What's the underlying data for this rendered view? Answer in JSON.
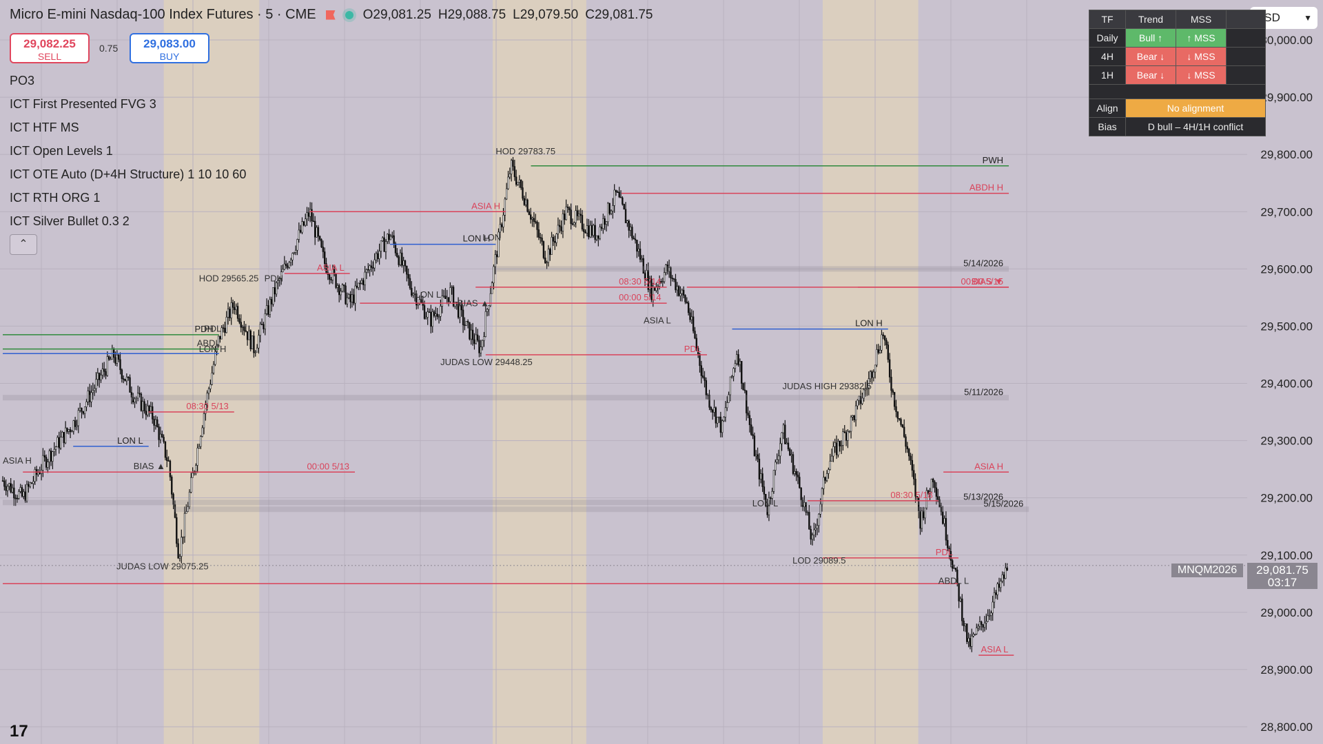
{
  "header": {
    "symbol_title": "Micro E-mini Nasdaq-100 Index Futures · 5 · CME",
    "open": "O29,081.25",
    "high": "H29,088.75",
    "low": "L29,079.50",
    "close": "C29,081.75"
  },
  "trade": {
    "sell_price": "29,082.25",
    "sell_label": "SELL",
    "spread": "0.75",
    "buy_price": "29,083.00",
    "buy_label": "BUY"
  },
  "indicators": [
    "PO3",
    "ICT First Presented FVG 3",
    "ICT HTF MS",
    "ICT Open Levels 1",
    "ICT OTE Auto (D+4H Structure) 1 10 10 60",
    "ICT RTH ORG 1",
    "ICT Silver Bullet 0.3 2"
  ],
  "collapse_glyph": "⌃",
  "currency": "USD",
  "mtf_table": {
    "headers": [
      "TF",
      "Trend",
      "MSS"
    ],
    "rows": [
      {
        "tf": "Daily",
        "trend": "Bull ↑",
        "mss": "↑ MSS"
      },
      {
        "tf": "4H",
        "trend": "Bear ↓",
        "mss": "↓ MSS"
      },
      {
        "tf": "1H",
        "trend": "Bear ↓",
        "mss": "↓ MSS"
      }
    ],
    "align_label": "Align",
    "align_value": "No alignment",
    "bias_label": "Bias",
    "bias_value": "D bull – 4H/1H conflict"
  },
  "last_price": {
    "symbol": "MNQM2026",
    "price": "29,081.75",
    "countdown": "03:17"
  },
  "logo_text": "17",
  "colors": {
    "up_session": "#e2d4b8",
    "background": "#c9c2cf",
    "level_red": "#d9435a",
    "level_green": "#2f8a3c",
    "level_blue": "#2f5fd0",
    "candles": "#111111"
  },
  "chart_data": {
    "type": "line",
    "title": "Micro E-mini Nasdaq-100 Index Futures · 5 · CME",
    "xlabel": "",
    "ylabel": "",
    "ylim": [
      28800,
      30000
    ],
    "y_ticks": [
      30000,
      29900,
      29800,
      29700,
      29600,
      29500,
      29400,
      29300,
      29200,
      29100,
      29000,
      28900,
      28800
    ],
    "y_tick_labels": [
      "30,000.00",
      "29,900.00",
      "29,800.00",
      "29,700.00",
      "29,600.00",
      "29,500.00",
      "29,400.00",
      "29,300.00",
      "29,200.00",
      "29,100.00",
      "29,000.00",
      "28,900.00",
      "28,800.00"
    ],
    "x_range": [
      0,
      1000
    ],
    "price_path": [
      {
        "t": 0,
        "p": 29230
      },
      {
        "t": 20,
        "p": 29200
      },
      {
        "t": 40,
        "p": 29260
      },
      {
        "t": 70,
        "p": 29330
      },
      {
        "t": 90,
        "p": 29390
      },
      {
        "t": 110,
        "p": 29450
      },
      {
        "t": 130,
        "p": 29380
      },
      {
        "t": 150,
        "p": 29340
      },
      {
        "t": 165,
        "p": 29260
      },
      {
        "t": 175,
        "p": 29100
      },
      {
        "t": 185,
        "p": 29200
      },
      {
        "t": 200,
        "p": 29350
      },
      {
        "t": 215,
        "p": 29480
      },
      {
        "t": 230,
        "p": 29540
      },
      {
        "t": 250,
        "p": 29460
      },
      {
        "t": 270,
        "p": 29560
      },
      {
        "t": 290,
        "p": 29640
      },
      {
        "t": 305,
        "p": 29700
      },
      {
        "t": 320,
        "p": 29610
      },
      {
        "t": 345,
        "p": 29540
      },
      {
        "t": 370,
        "p": 29620
      },
      {
        "t": 385,
        "p": 29660
      },
      {
        "t": 405,
        "p": 29570
      },
      {
        "t": 425,
        "p": 29510
      },
      {
        "t": 445,
        "p": 29560
      },
      {
        "t": 460,
        "p": 29500
      },
      {
        "t": 475,
        "p": 29460
      },
      {
        "t": 490,
        "p": 29620
      },
      {
        "t": 505,
        "p": 29780
      },
      {
        "t": 520,
        "p": 29720
      },
      {
        "t": 540,
        "p": 29620
      },
      {
        "t": 560,
        "p": 29700
      },
      {
        "t": 590,
        "p": 29660
      },
      {
        "t": 610,
        "p": 29730
      },
      {
        "t": 630,
        "p": 29640
      },
      {
        "t": 645,
        "p": 29560
      },
      {
        "t": 660,
        "p": 29600
      },
      {
        "t": 680,
        "p": 29540
      },
      {
        "t": 700,
        "p": 29380
      },
      {
        "t": 715,
        "p": 29320
      },
      {
        "t": 730,
        "p": 29460
      },
      {
        "t": 745,
        "p": 29300
      },
      {
        "t": 760,
        "p": 29180
      },
      {
        "t": 775,
        "p": 29320
      },
      {
        "t": 795,
        "p": 29200
      },
      {
        "t": 805,
        "p": 29120
      },
      {
        "t": 820,
        "p": 29260
      },
      {
        "t": 840,
        "p": 29320
      },
      {
        "t": 860,
        "p": 29400
      },
      {
        "t": 875,
        "p": 29490
      },
      {
        "t": 885,
        "p": 29380
      },
      {
        "t": 900,
        "p": 29280
      },
      {
        "t": 912,
        "p": 29160
      },
      {
        "t": 925,
        "p": 29240
      },
      {
        "t": 945,
        "p": 29080
      },
      {
        "t": 960,
        "p": 28940
      },
      {
        "t": 980,
        "p": 29000
      },
      {
        "t": 1000,
        "p": 29082
      }
    ],
    "levels": [
      {
        "label": "PWH",
        "price": 29780,
        "t0": 525,
        "t1": 1000,
        "color": "#2f8a3c"
      },
      {
        "label": "ABDH H",
        "price": 29732,
        "t0": 615,
        "t1": 1000,
        "color": "#d9435a"
      },
      {
        "label": "5/14/2026",
        "price": 29600,
        "t0": 490,
        "t1": 1000,
        "color": "#8a8690"
      },
      {
        "label": "BIAS ▼",
        "price": 29568,
        "t0": 680,
        "t1": 1000,
        "color": "#d9435a"
      },
      {
        "label": "08:30 5/14",
        "price": 29568,
        "t0": 470,
        "t1": 660,
        "color": "#d9435a"
      },
      {
        "label": "00:00 5/14",
        "price": 29540,
        "t0": 355,
        "t1": 660,
        "color": "#d9435a"
      },
      {
        "label": "00:00 5/15",
        "price": 29568,
        "t0": 850,
        "t1": 1000,
        "color": "#d9435a"
      },
      {
        "label": "LON H",
        "price": 29495,
        "t0": 725,
        "t1": 880,
        "color": "#2f5fd0"
      },
      {
        "label": "PDL",
        "price": 29450,
        "t0": 480,
        "t1": 700,
        "color": "#d9435a"
      },
      {
        "label": "5/11/2026",
        "price": 29375,
        "t0": 0,
        "t1": 1000,
        "color": "#8a8690"
      },
      {
        "label": "08:30 5/13",
        "price": 29350,
        "t0": 145,
        "t1": 230,
        "color": "#d9435a"
      },
      {
        "label": "LON L",
        "price": 29290,
        "t0": 70,
        "t1": 145,
        "color": "#2f5fd0"
      },
      {
        "label": "00:00 5/13",
        "price": 29245,
        "t0": 20,
        "t1": 350,
        "color": "#d9435a"
      },
      {
        "label": "ASIA H",
        "price": 29245,
        "t0": 935,
        "t1": 1000,
        "color": "#d9435a"
      },
      {
        "label": "5/13/2026",
        "price": 29192,
        "t0": 0,
        "t1": 1000,
        "color": "#8a8690"
      },
      {
        "label": "5/15/2026",
        "price": 29180,
        "t0": 170,
        "t1": 1020,
        "color": "#8a8690"
      },
      {
        "label": "08:30 5/18",
        "price": 29195,
        "t0": 800,
        "t1": 930,
        "color": "#d9435a"
      },
      {
        "label": "PDL",
        "price": 29095,
        "t0": 815,
        "t1": 950,
        "color": "#d9435a"
      },
      {
        "label": "",
        "price": 29050,
        "t0": 0,
        "t1": 950,
        "color": "#d9435a"
      },
      {
        "label": "ASIA L",
        "price": 28925,
        "t0": 970,
        "t1": 1005,
        "color": "#d9435a"
      },
      {
        "label": "PDH",
        "price": 29485,
        "t0": 0,
        "t1": 215,
        "color": "#2f8a3c"
      },
      {
        "label": "",
        "price": 29460,
        "t0": 0,
        "t1": 215,
        "color": "#2f8a3c"
      },
      {
        "label": "",
        "price": 29452,
        "t0": 0,
        "t1": 215,
        "color": "#2f5fd0"
      },
      {
        "label": "ASIA H",
        "price": 29700,
        "t0": 305,
        "t1": 500,
        "color": "#d9435a"
      },
      {
        "label": "ASIA L",
        "price": 29592,
        "t0": 280,
        "t1": 345,
        "color": "#d9435a"
      },
      {
        "label": "LON H",
        "price": 29643,
        "t0": 385,
        "t1": 490,
        "color": "#2f5fd0"
      }
    ],
    "annotations": [
      {
        "text": "HOD  29783.75",
        "t": 490,
        "p": 29800
      },
      {
        "text": "HOD  29565.25",
        "t": 195,
        "p": 29578
      },
      {
        "text": "JUDAS LOW  29448.25",
        "t": 435,
        "p": 29432
      },
      {
        "text": "JUDAS HIGH  29382.5",
        "t": 775,
        "p": 29390
      },
      {
        "text": "LOD  29089.5",
        "t": 785,
        "p": 29085
      },
      {
        "text": "JUDAS LOW  29075.25",
        "t": 113,
        "p": 29075
      },
      {
        "text": "ASIA L",
        "t": 637,
        "p": 29505
      },
      {
        "text": "ASIA H",
        "t": 0,
        "p": 29260
      },
      {
        "text": "BIAS ▲",
        "t": 130,
        "p": 29250
      },
      {
        "text": "BIAS ▲",
        "t": 452,
        "p": 29535
      },
      {
        "text": "LON L",
        "t": 410,
        "p": 29550
      },
      {
        "text": "LON",
        "t": 477,
        "p": 29650
      },
      {
        "text": "LON L",
        "t": 745,
        "p": 29185
      },
      {
        "text": "ABDL L",
        "t": 930,
        "p": 29050
      },
      {
        "text": "PDH",
        "t": 260,
        "p": 29578
      },
      {
        "text": "ABDL",
        "t": 193,
        "p": 29465
      },
      {
        "text": "PDL",
        "t": 200,
        "p": 29490
      },
      {
        "text": "LON H",
        "t": 195,
        "p": 29455
      }
    ],
    "session_shading": [
      {
        "t0": 160,
        "t1": 255
      },
      {
        "t0": 487,
        "t1": 580
      },
      {
        "t0": 815,
        "t1": 910
      }
    ],
    "grid": true
  }
}
